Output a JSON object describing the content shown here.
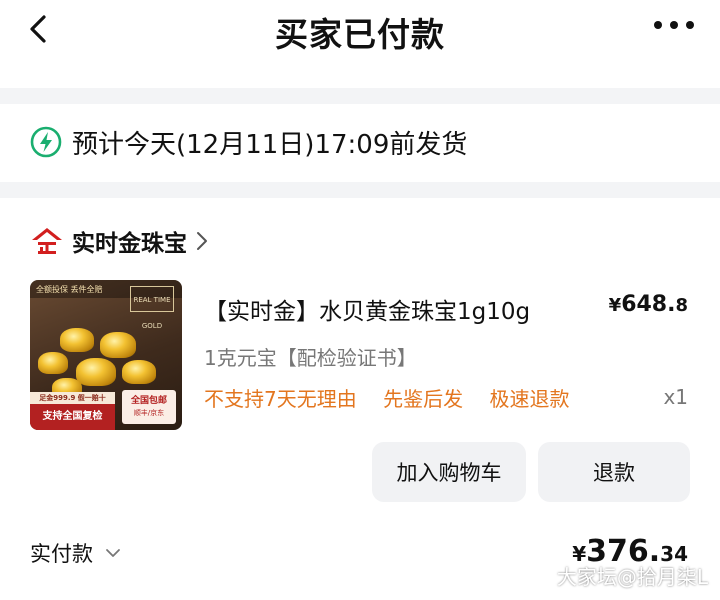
{
  "header": {
    "title": "买家已付款",
    "back_icon": "chevron-left-icon",
    "more_icon": "more-dots-icon"
  },
  "shipping": {
    "icon": "lightning-bolt-icon",
    "icon_color": "#1aae6f",
    "text": "预计今天(12月11日)17:09前发货"
  },
  "shop": {
    "logo_icon": "shop-logo-icon",
    "logo_color": "#d21f1f",
    "name": "实时金珠宝"
  },
  "product": {
    "thumbnail": {
      "top_text": "全额投保 丢件全赔",
      "brand_text": "REAL TIME GOLD",
      "red_strip_small": "足金999.9 假一赔十",
      "red_strip": "支持全国复检",
      "badge_line1": "全国包邮",
      "badge_line2": "顺丰/京东"
    },
    "title": "【实时金】水贝黄金珠宝1g10g",
    "price_currency": "¥",
    "price_main": "648.",
    "price_decimal": "8",
    "spec": "1克元宝【配检验证书】",
    "tags": [
      "不支持7天无理由",
      "先鉴后发",
      "极速退款"
    ],
    "tag_color": "#e3761f",
    "quantity": "x1"
  },
  "actions": {
    "add_to_cart": "加入购物车",
    "refund": "退款"
  },
  "payment": {
    "label": "实付款",
    "currency": "¥",
    "amount_int": "376.",
    "amount_dec": "34"
  },
  "watermark": "大家坛@拾月柒L"
}
